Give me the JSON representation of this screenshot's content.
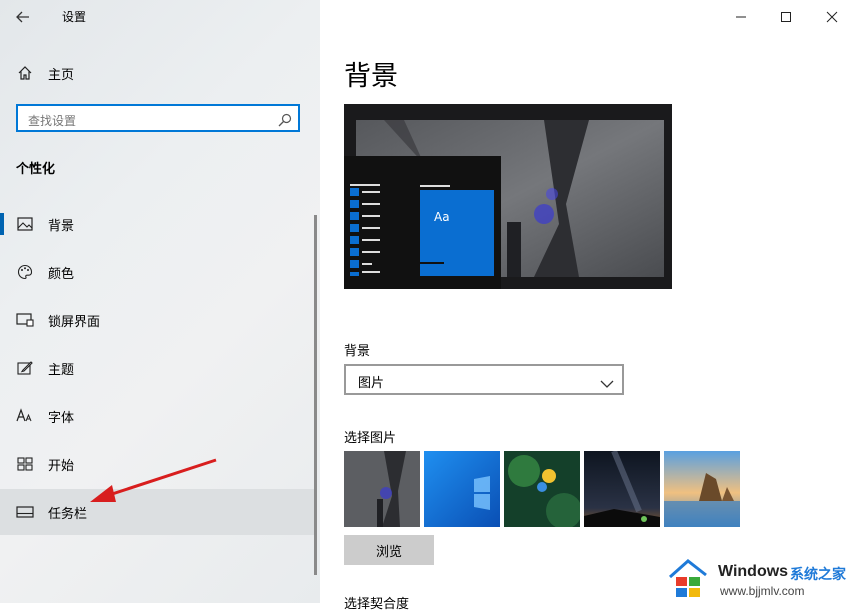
{
  "app": {
    "title": "设置"
  },
  "sidebar": {
    "home_label": "主页",
    "search_placeholder": "查找设置",
    "section_title": "个性化",
    "items": [
      {
        "label": "背景",
        "icon": "picture-icon"
      },
      {
        "label": "颜色",
        "icon": "palette-icon"
      },
      {
        "label": "锁屏界面",
        "icon": "lock-screen-icon"
      },
      {
        "label": "主题",
        "icon": "theme-brush-icon"
      },
      {
        "label": "字体",
        "icon": "font-icon"
      },
      {
        "label": "开始",
        "icon": "start-grid-icon"
      },
      {
        "label": "任务栏",
        "icon": "taskbar-icon"
      }
    ]
  },
  "preview": {
    "tile_text": "Aa"
  },
  "main": {
    "page_title": "背景",
    "background_label": "背景",
    "background_value": "图片",
    "choose_picture_label": "选择图片",
    "browse_label": "浏览",
    "fit_label": "选择契合度"
  },
  "watermark": {
    "brand": "Windows",
    "brand_cn": "系统之家",
    "url": "www.bjjmlv.com"
  },
  "colors": {
    "accent": "#0078d7",
    "annotation_arrow": "#d81e1e"
  }
}
